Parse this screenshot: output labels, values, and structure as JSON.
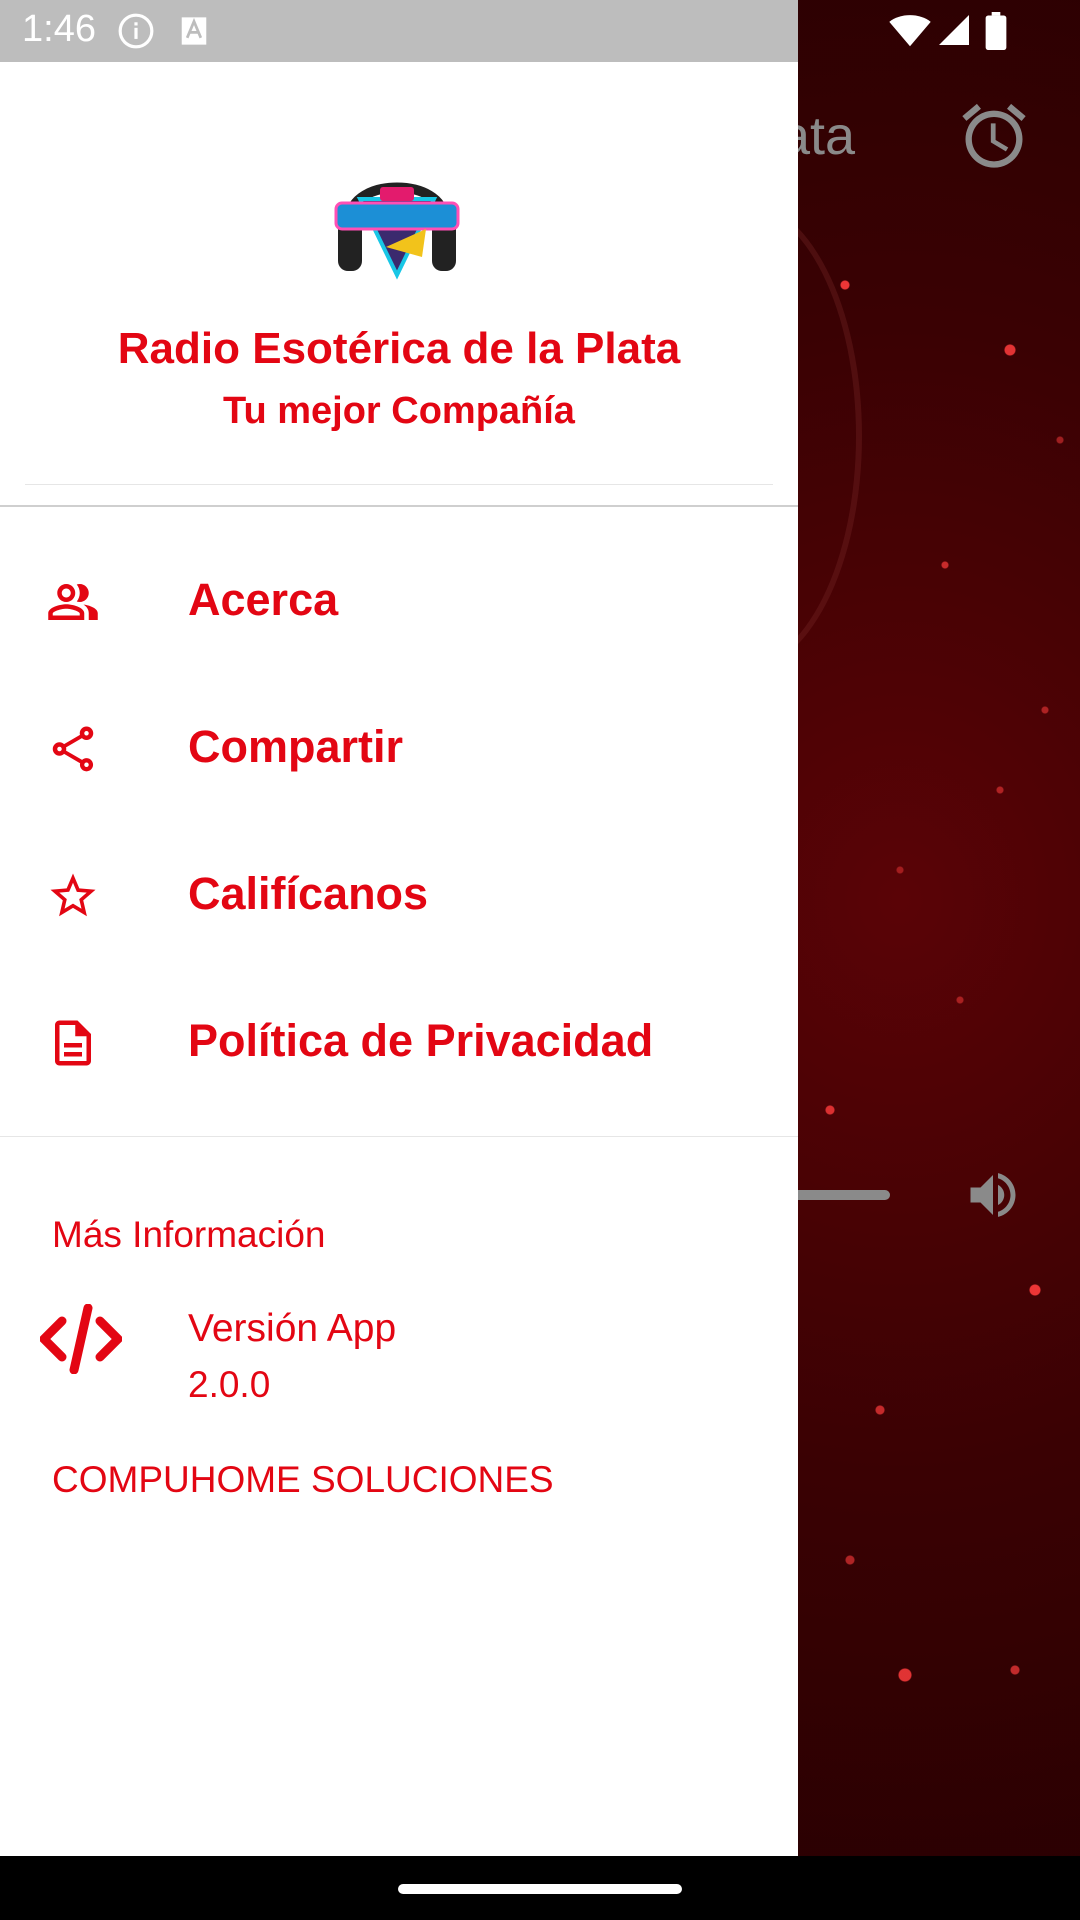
{
  "status_bar": {
    "time": "1:46",
    "icons": [
      "info-icon",
      "a-icon",
      "wifi-icon",
      "signal-icon",
      "battery-icon"
    ]
  },
  "background": {
    "title_fragment": "ata",
    "icons": [
      "alarm-icon",
      "volume-icon"
    ]
  },
  "drawer": {
    "app_name": "Radio Esotérica de la Plata",
    "tagline": "Tu mejor Compañía",
    "menu": [
      {
        "label": "Acerca",
        "icon": "people-icon"
      },
      {
        "label": "Compartir",
        "icon": "share-icon"
      },
      {
        "label": "Califícanos",
        "icon": "star-icon"
      },
      {
        "label": "Política de Privacidad",
        "icon": "document-icon"
      }
    ],
    "more_info": {
      "section_title": "Más Información",
      "version_label": "Versión App",
      "version_value": "2.0.0",
      "version_icon": "code-icon",
      "developer": "COMPUHOME SOLUCIONES"
    }
  },
  "colors": {
    "accent": "#e30613",
    "drawer_bg": "#ffffff",
    "status_bar": "#bdbdbd",
    "player_bg": "#3a0103"
  }
}
